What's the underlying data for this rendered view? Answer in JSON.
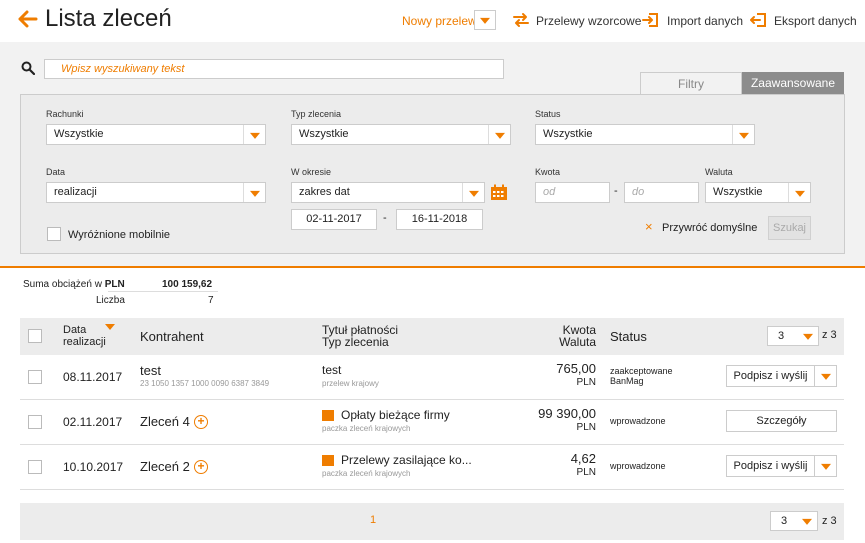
{
  "header": {
    "title": "Lista zleceń",
    "new_transfer": "Nowy przelew",
    "templates": "Przelewy wzorcowe",
    "import": "Import danych",
    "export": "Eksport danych"
  },
  "search": {
    "placeholder": "Wpisz wyszukiwany tekst",
    "tab_filters": "Filtry",
    "tab_advanced": "Zaawansowane"
  },
  "filters": {
    "accounts_label": "Rachunki",
    "accounts_value": "Wszystkie",
    "order_type_label": "Typ zlecenia",
    "order_type_value": "Wszystkie",
    "status_label": "Status",
    "status_value": "Wszystkie",
    "date_label": "Data",
    "date_value": "realizacji",
    "period_label": "W okresie",
    "period_value": "zakres dat",
    "date_from": "02-11-2017",
    "date_sep": "-",
    "date_to": "16-11-2018",
    "amount_label": "Kwota",
    "amount_from_ph": "od",
    "amount_sep": "-",
    "amount_to_ph": "do",
    "currency_label": "Waluta",
    "currency_value": "Wszystkie",
    "mobile_label": "Wyróżnione mobilnie",
    "restore_label": "Przywróć domyślne",
    "search_button": "Szukaj"
  },
  "summary": {
    "sum_label_prefix": "Suma obciążeń w",
    "sum_currency": "PLN",
    "sum_value": "100 159,62",
    "count_label": "Liczba",
    "count_value": "7"
  },
  "table": {
    "col_date_1": "Data",
    "col_date_2": "realizacji",
    "col_contractor": "Kontrahent",
    "col_title_1": "Tytuł płatności",
    "col_title_2": "Typ zlecenia",
    "col_amount_1": "Kwota",
    "col_amount_2": "Waluta",
    "col_status": "Status",
    "page_size": "3",
    "page_of": "z 3",
    "rows": [
      {
        "date": "08.11.2017",
        "contractor": "test",
        "account": "23 1050 1357 1000 0090 6387 3849",
        "title": "test",
        "type": "przelew krajowy",
        "amount": "765,00",
        "currency": "PLN",
        "status_1": "zaakceptowane",
        "status_2": "BanMag",
        "action": "Podpisz i wyślij"
      },
      {
        "date": "02.11.2017",
        "contractor": "Zleceń 4",
        "title": "Opłaty bieżące firmy",
        "type": "paczka zleceń krajowych",
        "amount": "99 390,00",
        "currency": "PLN",
        "status_1": "wprowadzone",
        "action": "Szczegóły"
      },
      {
        "date": "10.10.2017",
        "contractor": "Zleceń 2",
        "title": "Przelewy zasilające ko...",
        "type": "paczka zleceń krajowych",
        "amount": "4,62",
        "currency": "PLN",
        "status_1": "wprowadzone",
        "action": "Podpisz i wyślij"
      }
    ]
  },
  "footer": {
    "page": "1",
    "page_size": "3",
    "page_of": "z 3"
  },
  "colors": {
    "accent": "#ef7d00",
    "panel_bg": "#ececec"
  }
}
